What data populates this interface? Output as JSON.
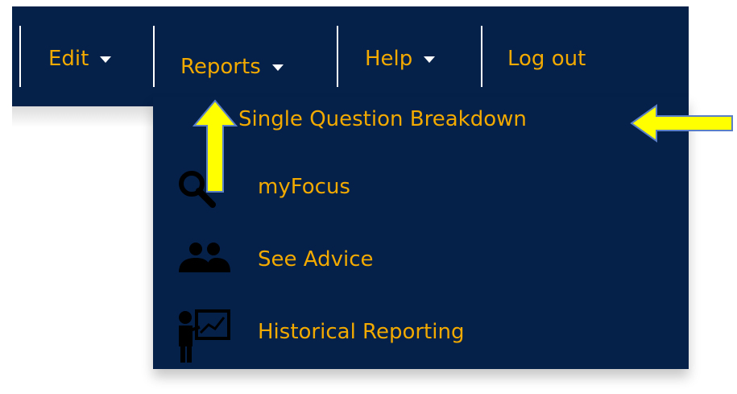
{
  "nav": {
    "edit_label": "Edit",
    "reports_label": "Reports",
    "help_label": "Help",
    "logout_label": "Log out"
  },
  "reports_menu": {
    "items": [
      {
        "label": "Single Question Breakdown",
        "icon": null
      },
      {
        "label": "myFocus",
        "icon": "magnifier-icon"
      },
      {
        "label": "See Advice",
        "icon": "people-icon"
      },
      {
        "label": "Historical Reporting",
        "icon": "presenter-chart-icon"
      }
    ]
  },
  "annotations": {
    "arrow_color": "#ffff00",
    "arrow_outline": "#5b7fc7"
  },
  "colors": {
    "navbar_bg": "#052049",
    "menu_text": "#f2a900",
    "separator": "#ffffff"
  }
}
